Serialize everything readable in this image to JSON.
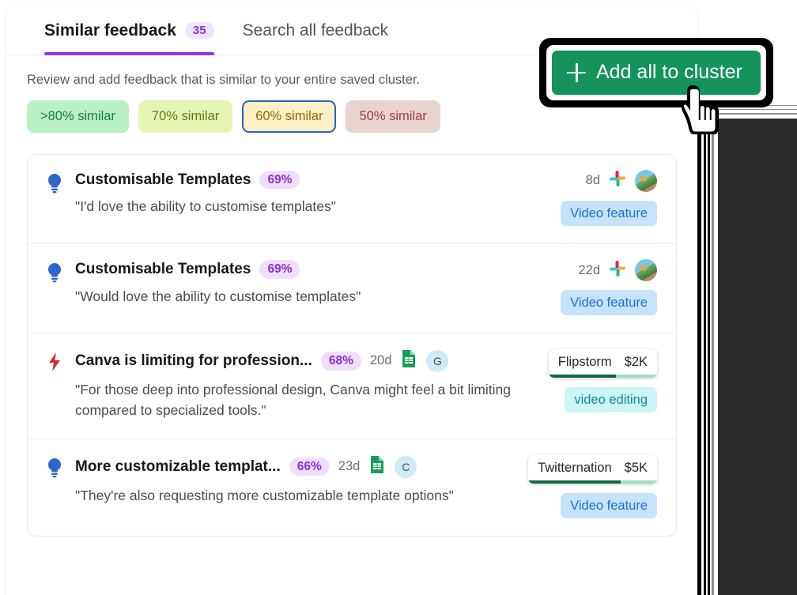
{
  "tabs": [
    {
      "label": "Similar feedback",
      "badge": "35",
      "active": true
    },
    {
      "label": "Search all feedback",
      "badge": "",
      "active": false
    }
  ],
  "description": "Review and add feedback that is similar to your entire saved cluster.",
  "filters": [
    {
      "label": ">80% similar",
      "selected": false
    },
    {
      "label": "70% similar",
      "selected": false
    },
    {
      "label": "60% similar",
      "selected": true
    },
    {
      "label": "50% similar",
      "selected": false
    }
  ],
  "cta": {
    "label": "Add all to cluster",
    "icon": "plus-icon",
    "color": "#14935e",
    "highlight_color": "#000000"
  },
  "feedback": [
    {
      "icon": "lightbulb-icon",
      "icon_color": "#2f64cf",
      "title": "Customisable Templates",
      "percent": "69%",
      "age": "8d",
      "quote": "\"I'd love the ability to customise templates\"",
      "source_icon": "slack-icon",
      "avatar": {
        "type": "photo",
        "label": ""
      },
      "tag": {
        "label": "Video feature",
        "style": "blue"
      },
      "org": null
    },
    {
      "icon": "lightbulb-icon",
      "icon_color": "#2f64cf",
      "title": "Customisable Templates",
      "percent": "69%",
      "age": "22d",
      "quote": "\"Would love the ability to customise templates\"",
      "source_icon": "slack-icon",
      "avatar": {
        "type": "photo",
        "label": ""
      },
      "tag": {
        "label": "Video feature",
        "style": "blue"
      },
      "org": null
    },
    {
      "icon": "bolt-icon",
      "icon_color": "#cf3030",
      "title": "Canva is limiting for profession...",
      "percent": "68%",
      "age": "20d",
      "quote": "\"For those deep into professional design, Canva might feel a bit limiting compared to specialized tools.\"",
      "source_icon": "google-sheets-icon",
      "avatar": {
        "type": "letter",
        "label": "G"
      },
      "tag": {
        "label": "video editing",
        "style": "teal"
      },
      "org": {
        "name": "Flipstorm",
        "value": "$2K",
        "progress": 62
      }
    },
    {
      "icon": "lightbulb-icon",
      "icon_color": "#2f64cf",
      "title": "More customizable templat...",
      "percent": "66%",
      "age": "23d",
      "quote": "\"They're also requesting more customizable template options\"",
      "source_icon": "google-sheets-icon",
      "avatar": {
        "type": "letter",
        "label": "C"
      },
      "tag": {
        "label": "Video feature",
        "style": "blue"
      },
      "org": {
        "name": "Twitternation",
        "value": "$5K",
        "progress": 72
      }
    }
  ],
  "cursor": {
    "icon": "pointing-hand-cursor"
  }
}
